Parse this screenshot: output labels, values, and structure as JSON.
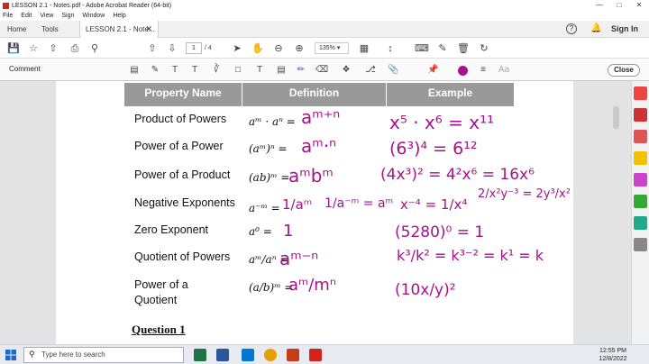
{
  "window": {
    "title": "LESSON 2.1 - Notes.pdf - Adobe Acrobat Reader (64-bit)"
  },
  "menu": [
    "File",
    "Edit",
    "View",
    "Sign",
    "Window",
    "Help"
  ],
  "tabs": {
    "home": "Home",
    "tools": "Tools",
    "document": "LESSON 2.1 - Note...",
    "sign_in": "Sign In"
  },
  "toolbar": {
    "page_current": "1",
    "page_total": "/ 4",
    "zoom": "135%"
  },
  "comment_bar": {
    "label": "Comment",
    "close": "Close"
  },
  "table": {
    "headers": [
      "Property Name",
      "Definition",
      "Example"
    ],
    "properties": [
      "Product of Powers",
      "Power of a Power",
      "Power of a Product",
      "Negative Exponents",
      "Zero Exponent",
      "Quotient of Powers",
      "Power of a",
      "Quotient"
    ],
    "printed_defs": [
      "aᵐ · aⁿ =",
      "(aᵐ)ⁿ =",
      "(ab)ᵐ =",
      "a⁻ᵐ =",
      "a⁰ =",
      "aᵐ/aⁿ =",
      "(a/b)ᵐ ="
    ],
    "handwritten_defs": [
      "aᵐ⁺ⁿ",
      "aᵐ·ⁿ",
      "aᵐbᵐ",
      "1/aᵐ",
      "1/a⁻ᵐ = aᵐ",
      "1",
      "aᵐ⁻ⁿ",
      "aᵐ/mⁿ"
    ],
    "handwritten_examples": [
      "x⁵ · x⁶ = x¹¹",
      "(6³)⁴ = 6¹²",
      "(4x³)² = 4²x⁶ = 16x⁶",
      "x⁻⁴ = 1/x⁴",
      "2/x²y⁻³ = 2y³/x²",
      "(5280)⁰ = 1",
      "k³/k² = k³⁻² = k¹ = k",
      "(10x/y)²"
    ]
  },
  "question": "Question 1",
  "taskbar": {
    "search_placeholder": "Type here to search",
    "time": "12:55 PM",
    "date": "12/8/2022"
  },
  "colors": {
    "ink": "#a5128c",
    "header_bg": "#999999",
    "close_border": "#999999"
  }
}
